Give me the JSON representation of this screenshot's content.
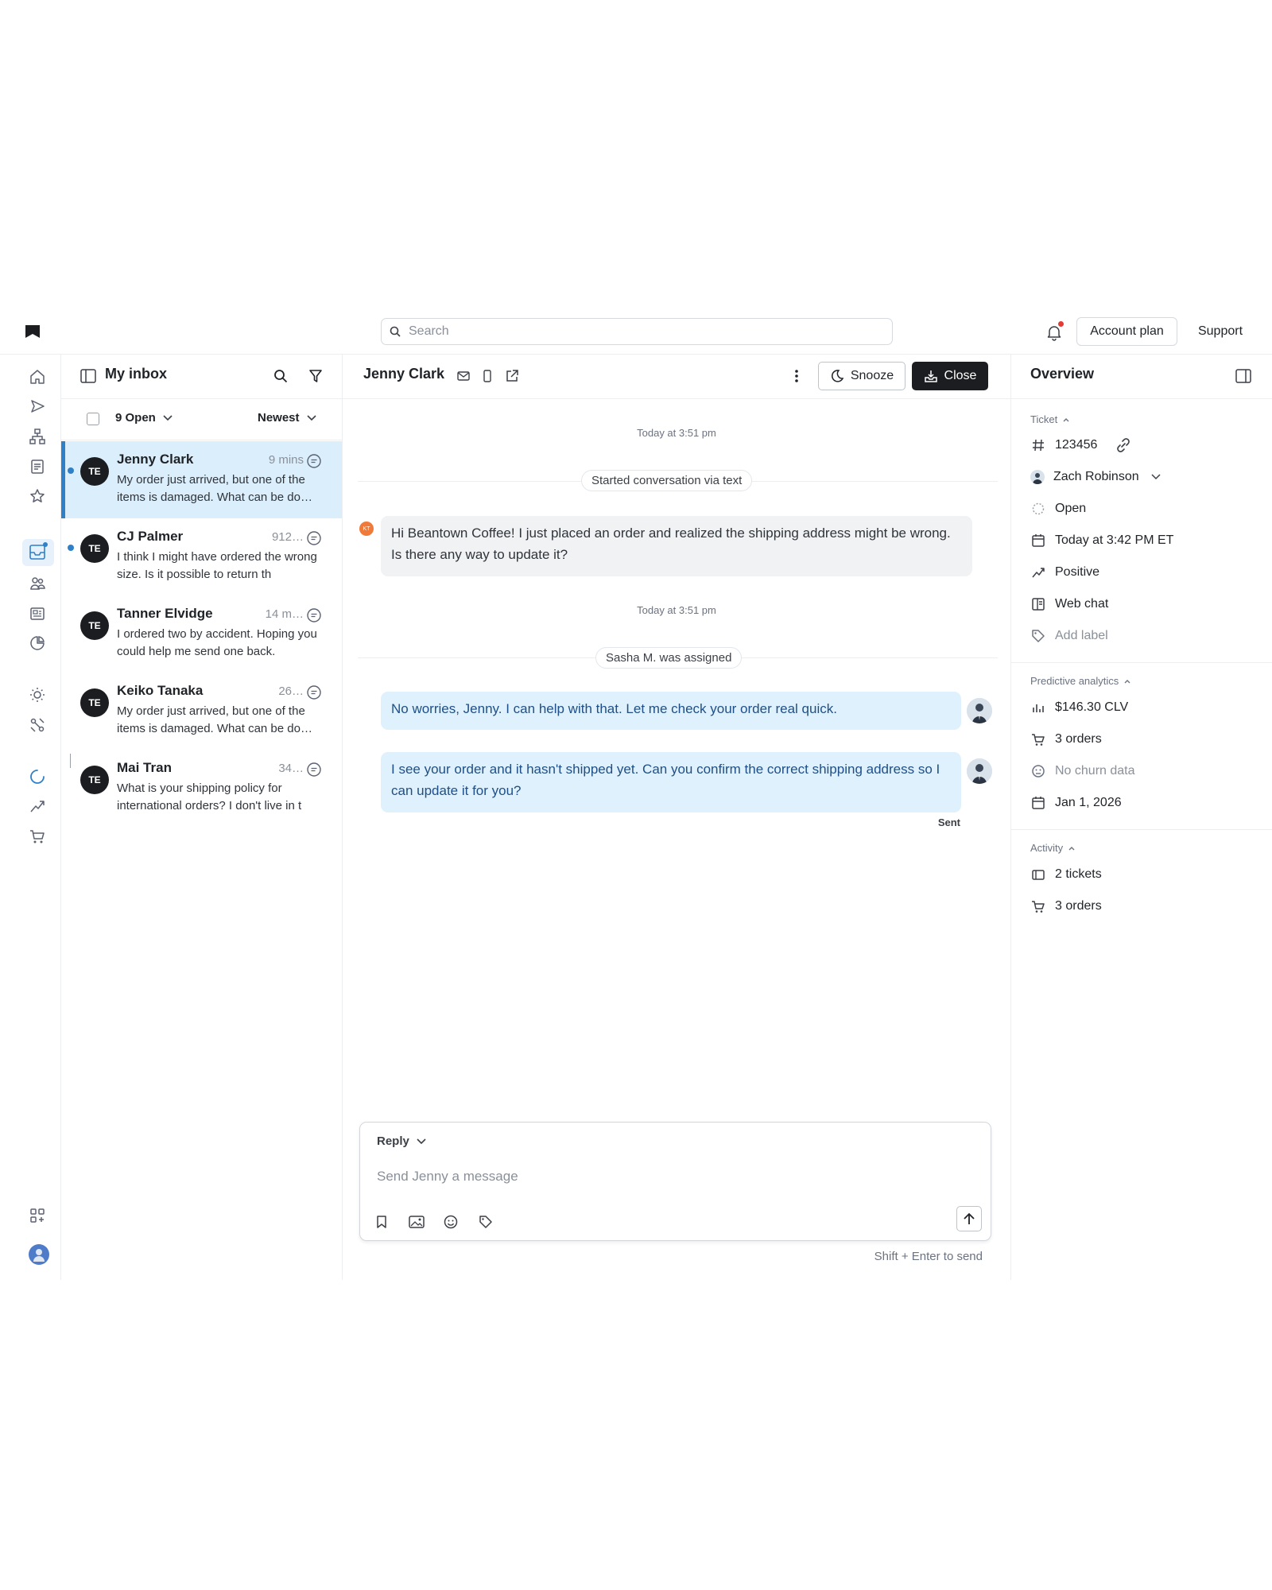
{
  "topbar": {
    "search_placeholder": "Search",
    "account_plan_label": "Account plan",
    "support_label": "Support"
  },
  "rail": {
    "icons": [
      "home-icon",
      "send-icon",
      "org-chart-icon",
      "document-icon",
      "star-icon",
      "inbox-icon",
      "users-icon",
      "newspaper-icon",
      "clock-chart-icon",
      "sun-icon",
      "routes-icon",
      "loader-icon",
      "trend-icon",
      "cart-icon",
      "apps-icon",
      "avatar"
    ]
  },
  "inbox": {
    "title": "My inbox",
    "open_filter": "9 Open",
    "sort": "Newest",
    "conversations": [
      {
        "initials": "TE",
        "name": "Jenny Clark",
        "time": "9 mins",
        "preview": "My order just arrived, but one of the items is damaged. What can be do…",
        "unread": true,
        "active": true
      },
      {
        "initials": "TE",
        "name": "CJ Palmer",
        "time": "912…",
        "preview": "I think I might have ordered the wrong size. Is it possible to return th",
        "unread": true,
        "active": false
      },
      {
        "initials": "TE",
        "name": "Tanner Elvidge",
        "time": "14 m…",
        "preview": "I ordered two by accident. Hoping you could help me send one back.",
        "unread": false,
        "active": false
      },
      {
        "initials": "TE",
        "name": "Keiko Tanaka",
        "time": "26…",
        "preview": "My order just arrived, but one of the items is damaged. What can be do…",
        "unread": false,
        "active": false
      },
      {
        "initials": "TE",
        "name": "Mai Tran",
        "time": "34…",
        "preview": "What is your shipping policy for international orders? I don't live in t",
        "unread": false,
        "active": false
      }
    ]
  },
  "chat": {
    "contact_name": "Jenny Clark",
    "snooze_label": "Snooze",
    "close_label": "Close",
    "timestamp_1": "Today at 3:51 pm",
    "system_1": "Started conversation via text",
    "customer_initials": "KT",
    "message_1": "Hi Beantown Coffee! I just placed an order and realized the shipping address might be wrong. Is there any way to update it?",
    "timestamp_2": "Today at 3:51 pm",
    "system_2": "Sasha M. was assigned",
    "message_2": "No worries, Jenny. I can help with that. Let me check your order real quick.",
    "message_3": "I see your order and it hasn't shipped yet. Can you confirm the correct shipping address so I can update it for you?",
    "status": "Sent"
  },
  "composer": {
    "mode_label": "Reply",
    "placeholder": "Send Jenny a message",
    "hint": "Shift + Enter to send"
  },
  "overview": {
    "title": "Overview",
    "ticket_section": "Ticket",
    "ticket_number": "123456",
    "assignee": "Zach Robinson",
    "status": "Open",
    "created": "Today at 3:42 PM ET",
    "sentiment": "Positive",
    "channel": "Web chat",
    "add_label": "Add label",
    "analytics_section": "Predictive analytics",
    "clv": "$146.30 CLV",
    "orders": "3 orders",
    "churn": "No churn data",
    "date": "Jan 1, 2026",
    "activity_section": "Activity",
    "tickets": "2 tickets",
    "activity_orders": "3 orders"
  },
  "colors": {
    "accent": "#2f80c7",
    "active_row_bg": "#dbeefb",
    "agent_bubble_bg": "#dff1fc",
    "customer_bubble_bg": "#f1f2f4",
    "close_button_bg": "#1b1d21",
    "notification_dot": "#e53935",
    "customer_avatar": "#f07a3a"
  }
}
